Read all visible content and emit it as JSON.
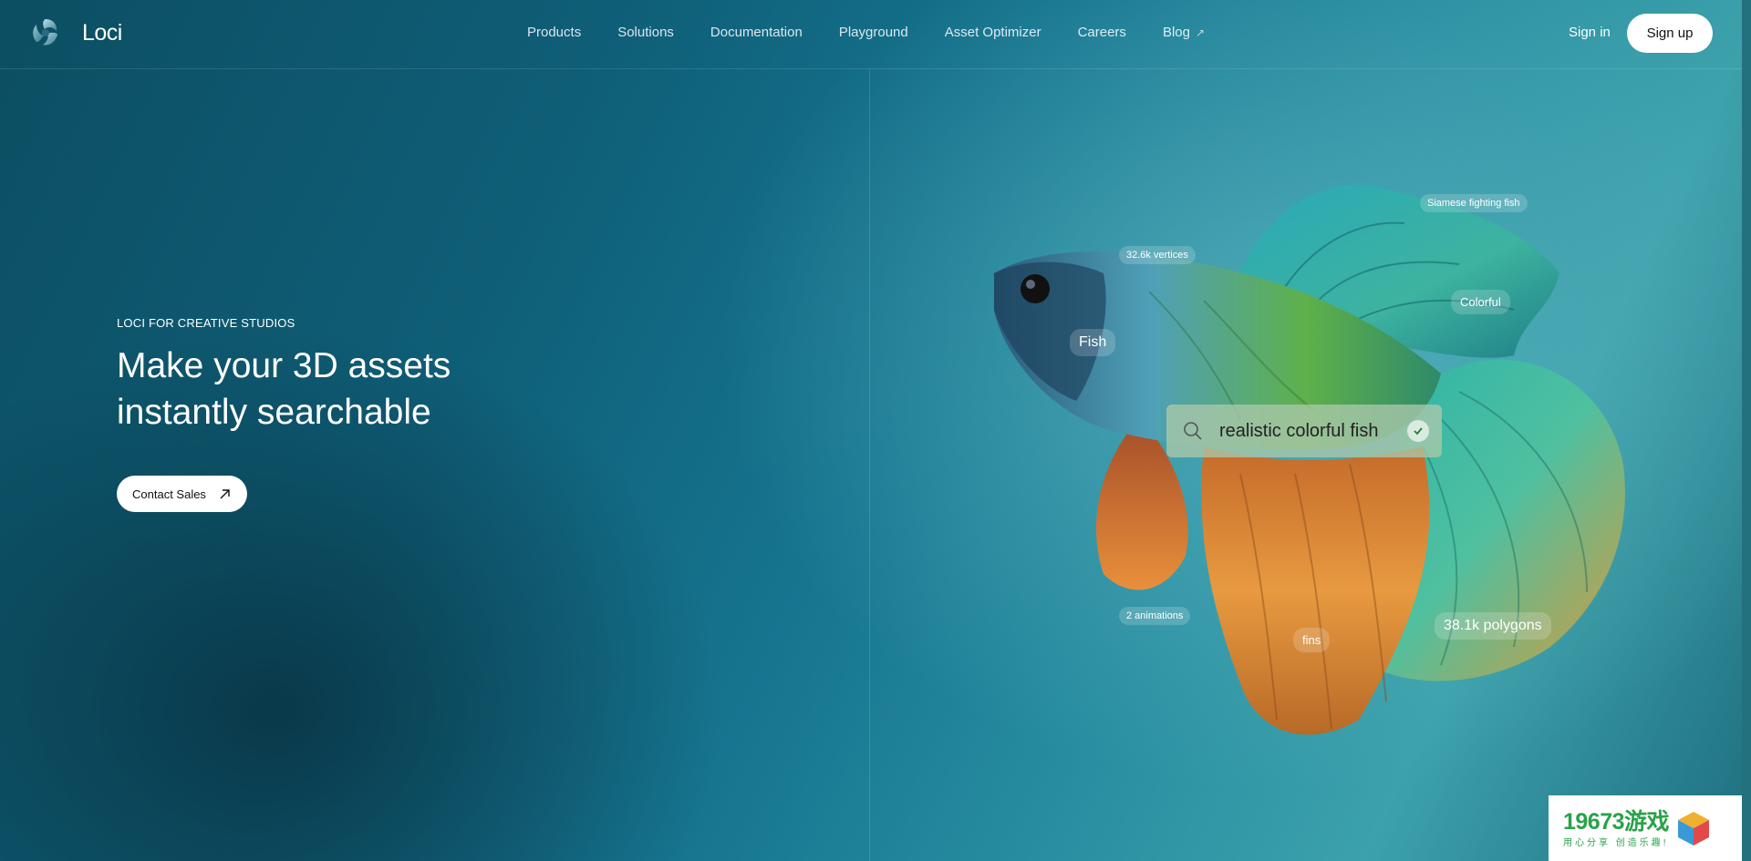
{
  "brand": {
    "name": "Loci"
  },
  "nav": {
    "items": [
      "Products",
      "Solutions",
      "Documentation",
      "Playground",
      "Asset Optimizer",
      "Careers"
    ],
    "blog_label": "Blog"
  },
  "auth": {
    "sign_in": "Sign in",
    "sign_up": "Sign up"
  },
  "hero": {
    "eyebrow": "LOCI FOR CREATIVE STUDIOS",
    "headline_line1": "Make your 3D assets",
    "headline_line2": "instantly searchable",
    "cta_label": "Contact Sales"
  },
  "tags": {
    "species": "Siamese fighting fish",
    "vertices": "32.6k vertices",
    "colorful": "Colorful",
    "fish": "Fish",
    "animations": "2 animations",
    "fins": "fins",
    "polygons": "38.1k polygons"
  },
  "search": {
    "query": "realistic colorful fish"
  },
  "badge": {
    "title": "19673游戏",
    "subtitle": "用心分享 创造乐趣!"
  },
  "colors": {
    "background_teal": "#167590",
    "button_white": "#ffffff",
    "badge_green": "#2aa24a"
  },
  "icons": [
    "loci-logo-icon",
    "external-arrow-icon",
    "arrow-up-right-icon",
    "search-icon",
    "check-icon",
    "cube-icon"
  ]
}
